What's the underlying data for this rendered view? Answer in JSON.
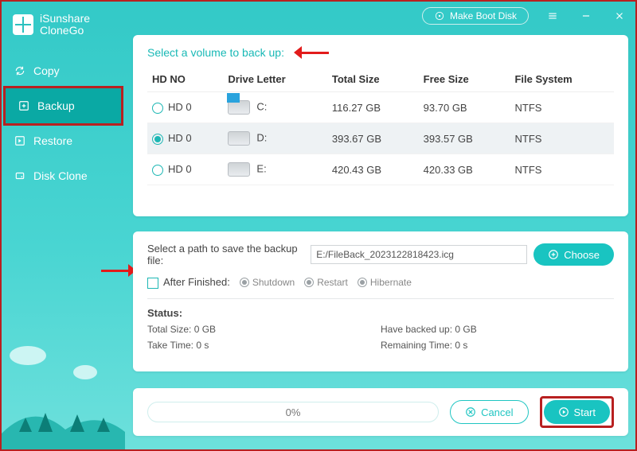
{
  "app": {
    "name_line1": "iSunshare",
    "name_line2": "CloneGo"
  },
  "titlebar": {
    "make_boot": "Make Boot Disk"
  },
  "nav": {
    "items": [
      {
        "label": "Copy"
      },
      {
        "label": "Backup"
      },
      {
        "label": "Restore"
      },
      {
        "label": "Disk Clone"
      }
    ]
  },
  "volumes": {
    "title": "Select a volume to back up:",
    "columns": {
      "hdno": "HD NO",
      "letter": "Drive Letter",
      "total": "Total Size",
      "free": "Free Size",
      "fs": "File System"
    },
    "rows": [
      {
        "hd": "HD 0",
        "letter": "C:",
        "total": "116.27 GB",
        "free": "93.70 GB",
        "fs": "NTFS",
        "selected": false,
        "os": true
      },
      {
        "hd": "HD 0",
        "letter": "D:",
        "total": "393.67 GB",
        "free": "393.57 GB",
        "fs": "NTFS",
        "selected": true,
        "os": false
      },
      {
        "hd": "HD 0",
        "letter": "E:",
        "total": "420.43 GB",
        "free": "420.33 GB",
        "fs": "NTFS",
        "selected": false,
        "os": false
      }
    ]
  },
  "dest": {
    "label": "Select a path to save the backup file:",
    "value": "E:/FileBack_2023122818423.icg",
    "choose": "Choose",
    "after_label": "After Finished:",
    "options": {
      "shutdown": "Shutdown",
      "restart": "Restart",
      "hibernate": "Hibernate"
    }
  },
  "status": {
    "heading": "Status:",
    "total_label": "Total Size: 0 GB",
    "backed_label": "Have backed up: 0 GB",
    "take_label": "Take Time: 0 s",
    "remain_label": "Remaining Time: 0 s"
  },
  "footer": {
    "percent": "0%",
    "cancel": "Cancel",
    "start": "Start"
  },
  "colors": {
    "accent": "#19c4c1",
    "highlight": "#b82020"
  }
}
